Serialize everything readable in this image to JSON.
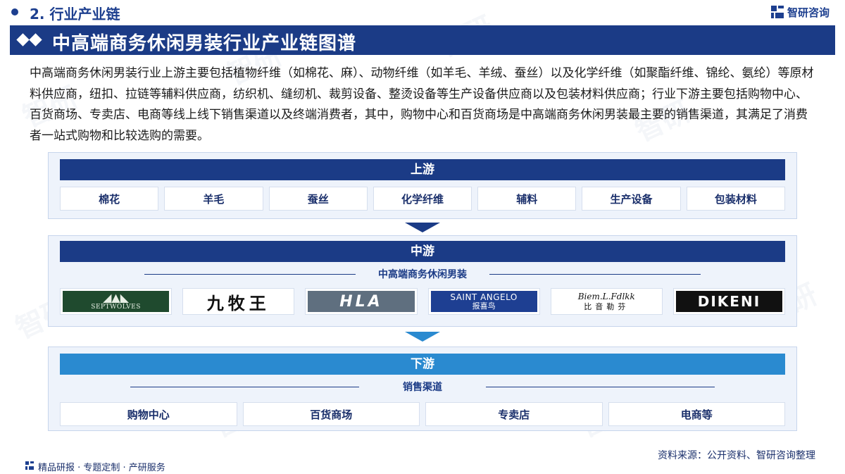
{
  "header": {
    "section_label": "2. 行业产业链",
    "logo_text": "智研咨询"
  },
  "title": "中高端商务休闲男装行业产业链图谱",
  "intro": "中高端商务休闲男装行业上游主要包括植物纤维（如棉花、麻）、动物纤维（如羊毛、羊绒、蚕丝）以及化学纤维（如聚酯纤维、锦纶、氨纶）等原材料供应商，纽扣、拉链等辅料供应商，纺织机、缝纫机、裁剪设备、整烫设备等生产设备供应商以及包装材料供应商；行业下游主要包括购物中心、百货商场、专卖店、电商等线上线下销售渠道以及终端消费者，其中，购物中心和百货商场是中高端商务休闲男装最主要的销售渠道，其满足了消费者一站式购物和比较选购的需要。",
  "upstream": {
    "label": "上游",
    "items": [
      "棉花",
      "羊毛",
      "蚕丝",
      "化学纤维",
      "辅料",
      "生产设备",
      "包装材料"
    ]
  },
  "midstream": {
    "label": "中游",
    "subhead": "中高端商务休闲男装",
    "brands": {
      "sept_name": "SEPTWOLVES",
      "jiu": "九牧王",
      "hla": "HLA",
      "saint_en": "SAINT ANGELO",
      "saint_cn": "报喜鸟",
      "biem_en": "Biem.L.Fdlkk",
      "biem_cn": "比音勒芬",
      "dikeni": "DIKENI"
    }
  },
  "downstream": {
    "label": "下游",
    "subhead": "销售渠道",
    "items": [
      "购物中心",
      "百货商场",
      "专卖店",
      "电商等"
    ]
  },
  "footer": {
    "source": "资料来源：公开资料、智研咨询整理",
    "slogan": "精品研报 · 专题定制 · 产研服务"
  },
  "colors": {
    "navy": "#1b3b86",
    "sky": "#2a8ad0",
    "panel_bg": "#eef3fb"
  }
}
